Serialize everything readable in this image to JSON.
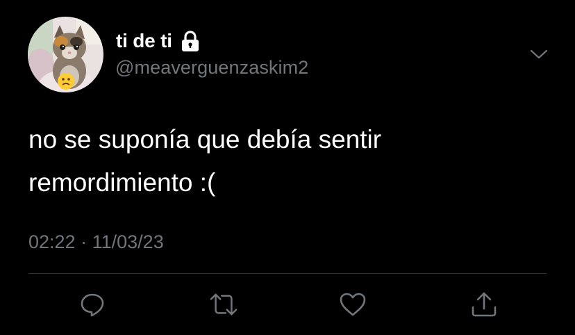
{
  "tweet": {
    "display_name": "ti de ti",
    "handle": "@meaverguenzaskim2",
    "text_lines": [
      "no se suponía que debía sentir",
      "remordimiento :("
    ],
    "time": "02:22",
    "separator": "·",
    "date": "11/03/23"
  },
  "icons": {
    "protected": "lock-icon",
    "more": "chevron-down-icon",
    "reply": "reply-icon",
    "retweet": "retweet-icon",
    "like": "heart-icon",
    "share": "share-icon"
  },
  "colors": {
    "background": "#000000",
    "primary_text": "#ffffff",
    "secondary_text": "#71767b",
    "divider": "#2f3336"
  }
}
